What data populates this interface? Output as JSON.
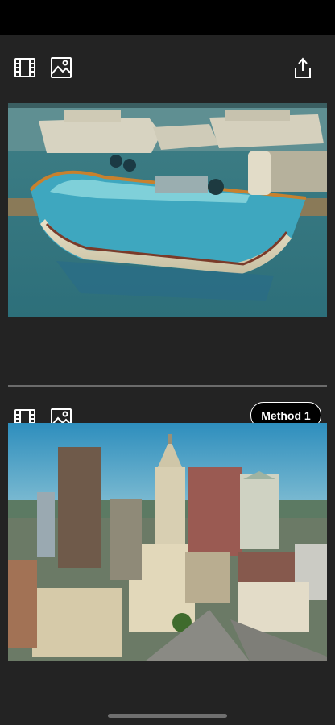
{
  "top_panel": {
    "video_icon": "film-icon",
    "image_icon": "image-icon",
    "share_icon": "share-icon"
  },
  "bottom_panel": {
    "video_icon": "film-icon",
    "image_icon": "image-icon",
    "method_label": "Method 1"
  },
  "colors": {
    "background": "#232323",
    "status_bar": "#000000",
    "icon": "#ffffff",
    "divider": "#6b6b6b"
  }
}
